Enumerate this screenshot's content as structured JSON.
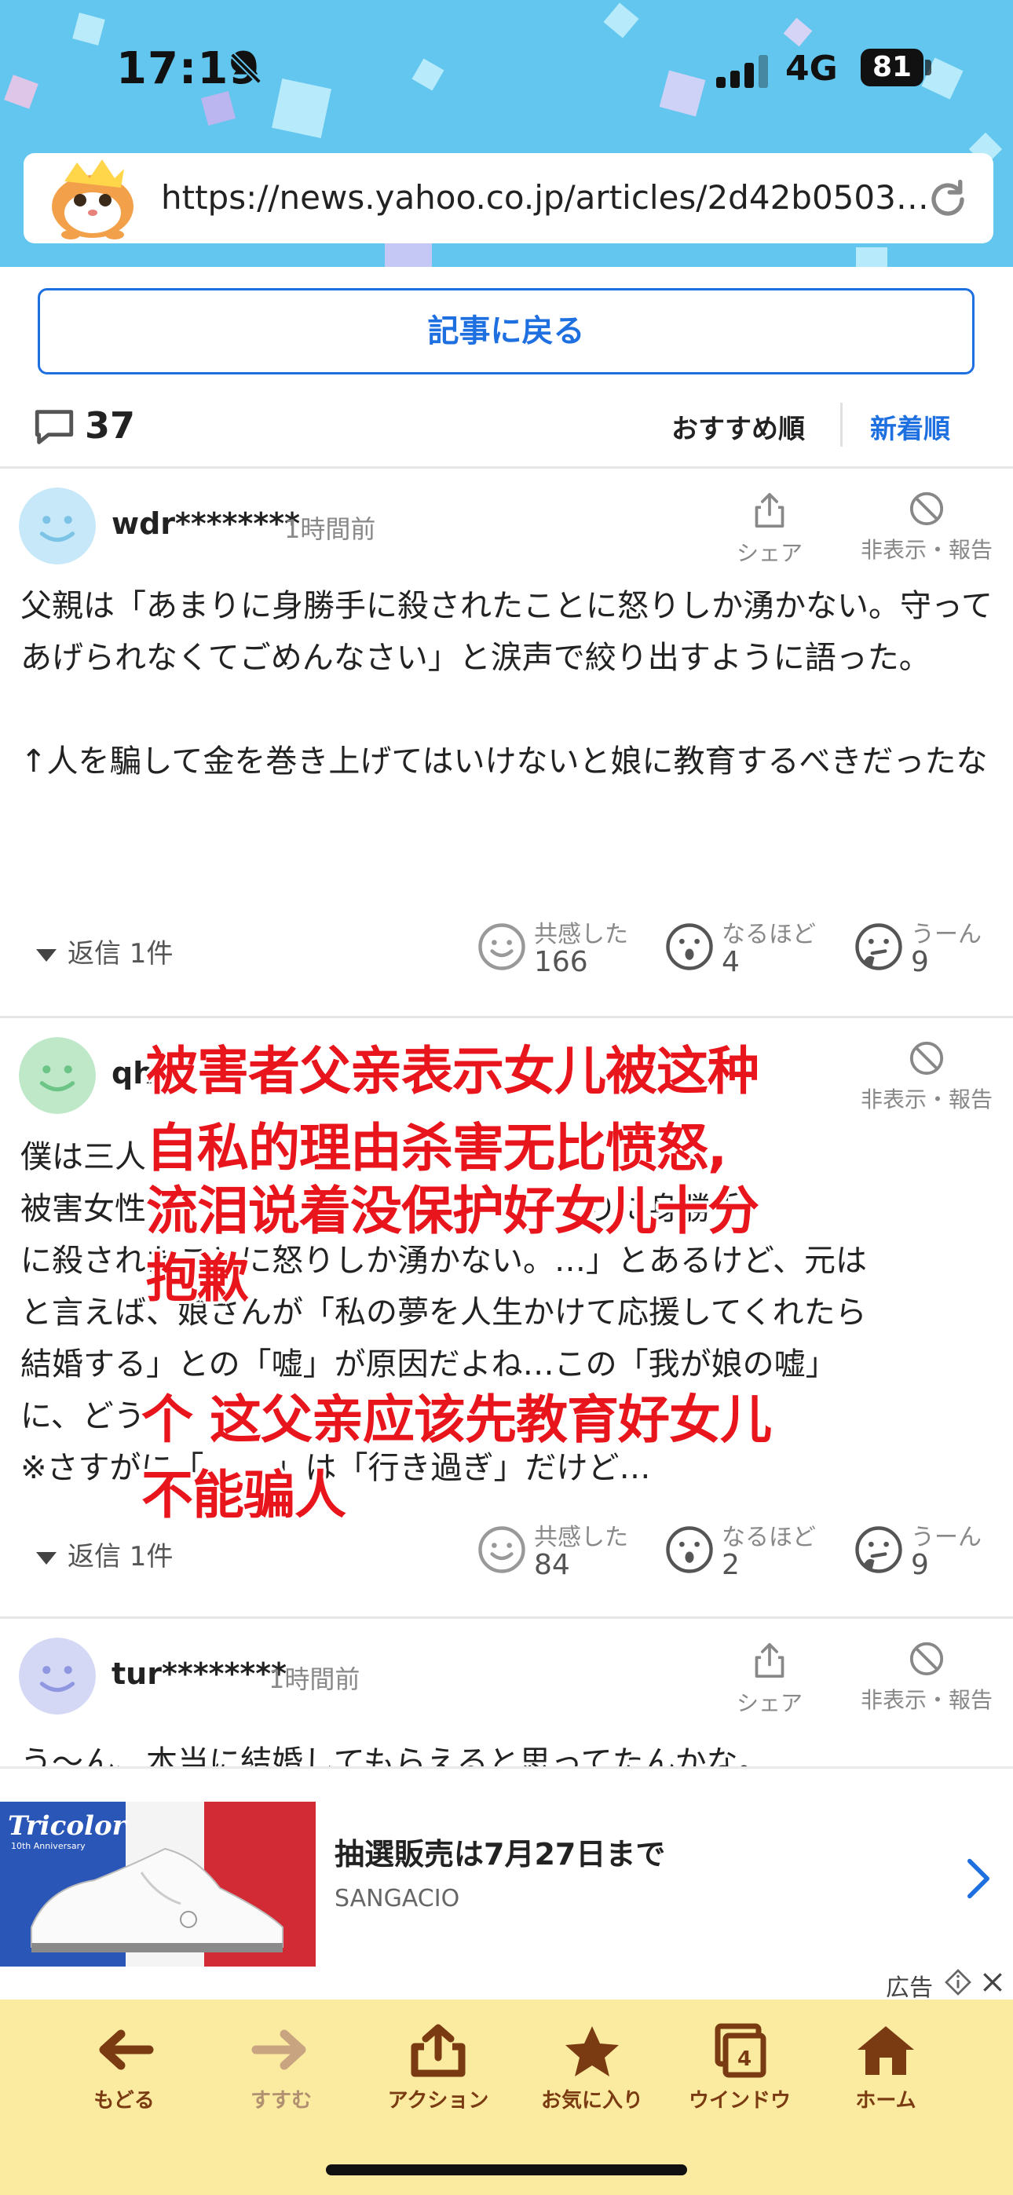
{
  "status_bar": {
    "time": "17:19",
    "network": "4G",
    "battery": "81"
  },
  "browser": {
    "url": "https://news.yahoo.co.jp/articles/2d42b0503…"
  },
  "page": {
    "back_button": "記事に戻る",
    "comment_count": "37",
    "sort_recommended": "おすすめ順",
    "sort_newest": "新着順"
  },
  "common": {
    "share": "シェア",
    "hide_report": "非表示・報告"
  },
  "comments": [
    {
      "user": "wdr********",
      "time": "1時間前",
      "body": "父親は「あまりに身勝手に殺されたことに怒りしか湧かない。守ってあげられなくてごめんなさい」と涙声で絞り出すように語った。\n\n↑人を騙して金を巻き上げてはいけないと娘に教育するべきだったな",
      "replies": "返信 1件",
      "reactions": [
        {
          "label": "共感した",
          "count": "166"
        },
        {
          "label": "なるほど",
          "count": "4"
        },
        {
          "label": "うーん",
          "count": "9"
        }
      ]
    },
    {
      "user": "qh",
      "body": "僕は三人\n被害女性                                            りに身勝手\nに殺されたことに怒りしか湧かない。…」とあるけど、元は\nと言えば、娘さんが「私の夢を人生かけて応援してくれたら\n結婚する」との「嘘」が原因だよね…この「我が娘の嘘」\nに、どう\n※さすがに「       」は「行き過ぎ」だけど…",
      "replies": "返信 1件",
      "reactions": [
        {
          "label": "共感した",
          "count": "84"
        },
        {
          "label": "なるほど",
          "count": "2"
        },
        {
          "label": "うーん",
          "count": "9"
        }
      ]
    },
    {
      "user": "tur********",
      "time": "1時間前",
      "body": "う～ん、本当に結婚してもらえると思ってたんかな。"
    }
  ],
  "overlay": {
    "lines_top": [
      "被害者父亲表示女儿被这种",
      "自私的理由杀害无比愤怒,",
      "流泪说着没保护好女儿十分",
      "抱歉"
    ],
    "lines_bottom": [
      "个 这父亲应该先教育好女儿",
      "不能骗人"
    ]
  },
  "ad": {
    "brand": "Tricolor",
    "brand_sub": "10th Anniversary",
    "title": "抽選販売は7月27日まで",
    "advertiser": "SANGACIO",
    "label": "広告"
  },
  "toolbar": {
    "items": [
      {
        "label": "もどる",
        "icon": "back-arrow-icon"
      },
      {
        "label": "すすむ",
        "icon": "forward-arrow-icon"
      },
      {
        "label": "アクション",
        "icon": "share-icon"
      },
      {
        "label": "お気に入り",
        "icon": "star-icon"
      },
      {
        "label": "ウインドウ",
        "icon": "windows-icon",
        "badge": "4"
      },
      {
        "label": "ホーム",
        "icon": "home-icon"
      }
    ]
  },
  "colors": {
    "accent_blue": "#1e6fe0",
    "header_blue": "#63c6ee",
    "overlay_red": "#e8151c",
    "toolbar_yellow": "#fbeba0",
    "toolbar_brown": "#7a3b12"
  }
}
